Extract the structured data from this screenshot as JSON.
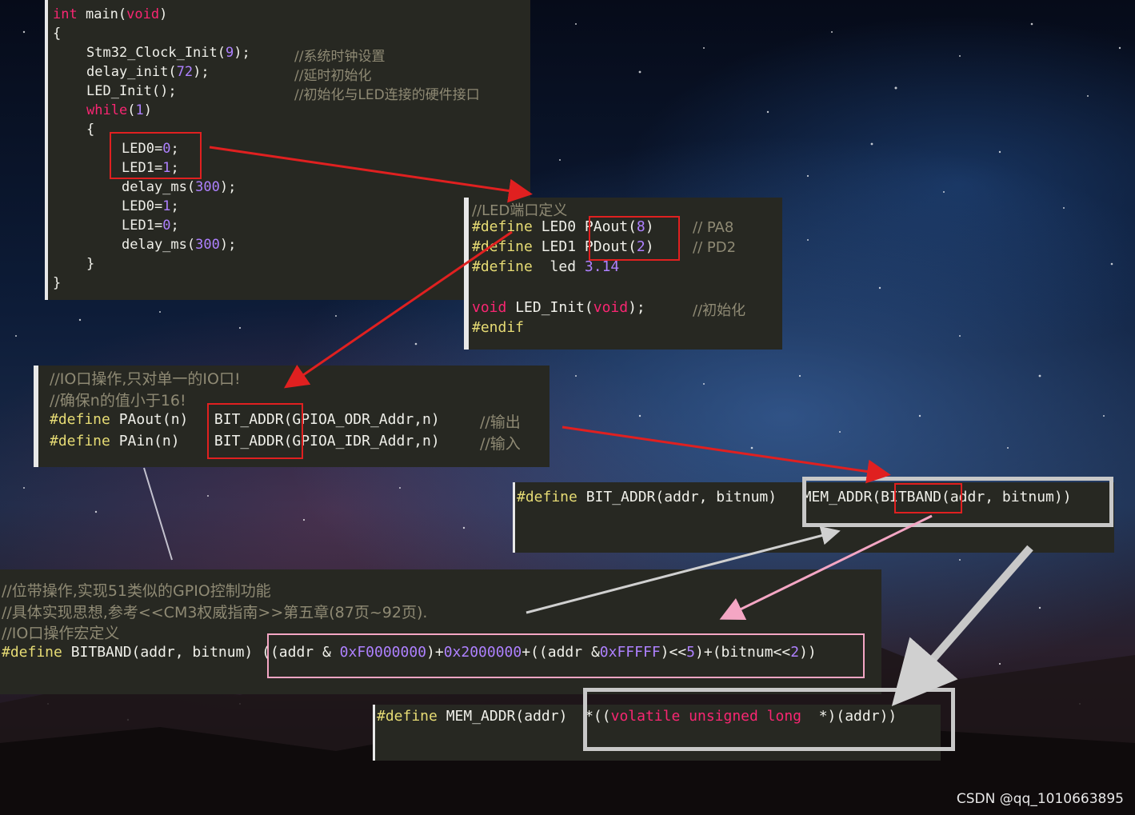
{
  "panel_main": {
    "l1_kw": "int",
    "l1_rest": " main(",
    "l1_void": "void",
    "l1_end": ")",
    "l2": "{",
    "l3_code": "Stm32_Clock_Init(",
    "l3_num": "9",
    "l3_end": ");",
    "l3_cm": "//系统时钟设置",
    "l4_code": "delay_init(",
    "l4_num": "72",
    "l4_end": ");",
    "l4_cm": "//延时初始化",
    "l5_code": "LED_Init();",
    "l5_cm": "//初始化与LED连接的硬件接口",
    "l6_kw": "while",
    "l6_open": "(",
    "l6_num": "1",
    "l6_end": ")",
    "l7": "{",
    "l8_code": "LED0=",
    "l8_num": "0",
    "l8_end": ";",
    "l9_code": "LED1=",
    "l9_num": "1",
    "l9_end": ";",
    "l10_code": "delay_ms(",
    "l10_num": "300",
    "l10_end": ");",
    "l11_code": "LED0=",
    "l11_num": "1",
    "l11_end": ";",
    "l12_code": "LED1=",
    "l12_num": "0",
    "l12_end": ";",
    "l13_code": "delay_ms(",
    "l13_num": "300",
    "l13_end": ");",
    "l14": "}",
    "l15": "}"
  },
  "panel_led": {
    "cm_title": "//LED端口定义",
    "d1_pp": "#define",
    "d1_name": " LED0 ",
    "d1_val": "PAout(",
    "d1_num": "8",
    "d1_end": ")",
    "d1_cm": "// PA8",
    "d2_pp": "#define",
    "d2_name": " LED1 ",
    "d2_val": "PDout(",
    "d2_num": "2",
    "d2_end": ")",
    "d2_cm": "// PD2",
    "d3_pp": "#define",
    "d3_name": "  led ",
    "d3_num": "3.14",
    "v_kw": "void",
    "v_mid": " LED_Init(",
    "v_void": "void",
    "v_end": ");",
    "v_cm": "//初始化",
    "endif": "#endif"
  },
  "panel_io": {
    "cm1": "//IO口操作,只对单一的IO口!",
    "cm2": "//确保n的值小于16!",
    "d1_pp": "#define",
    "d1_code": " PAout(n)   BIT_ADDR(GPIOA_ODR_Addr,n)",
    "d1_cm": "//输出",
    "d2_pp": "#define",
    "d2_code": " PAin(n)    BIT_ADDR(GPIOA_IDR_Addr,n)",
    "d2_cm": "//输入"
  },
  "panel_bitaddr": {
    "pp": "#define",
    "code": " BIT_ADDR(addr, bitnum)   MEM_ADDR(BITBAND(addr, bitnum))"
  },
  "panel_bitband": {
    "cm1": "//位带操作,实现51类似的GPIO控制功能",
    "cm2": "//具体实现思想,参考<<CM3权威指南>>第五章(87页~92页).",
    "cm3": "//IO口操作宏定义",
    "pp": "#define",
    "head": " BITBAND(addr, bitnum) ((addr & ",
    "n1": "0xF0000000",
    "p1": ")+",
    "n2": "0x2000000",
    "p2": "+((addr &",
    "n3": "0xFFFFF",
    "p3": ")<<",
    "n4": "5",
    "p4": ")+(bitnum<<",
    "n5": "2",
    "p5": "))"
  },
  "panel_memaddr": {
    "pp": "#define",
    "head": " MEM_ADDR(addr)  *((",
    "kw": "volatile unsigned long",
    "tail": "  *)(addr))"
  },
  "watermark": "CSDN @qq_1010663895",
  "colors": {
    "editor_bg": "#272822",
    "keyword": "#f92672",
    "number": "#ae81ff",
    "preprocessor": "#e6db74",
    "comment": "#8f8a74",
    "highlight_red": "#e02020",
    "highlight_pink": "#f4a6c4",
    "highlight_gray": "#c8c8c8"
  }
}
